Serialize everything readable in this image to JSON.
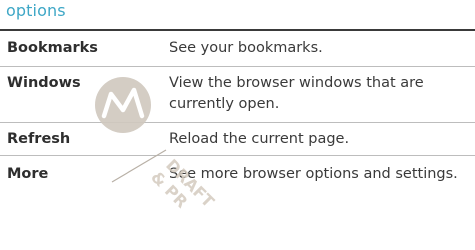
{
  "section": {
    "title": "options"
  },
  "options": [
    {
      "term": "Bookmarks",
      "description": "See your bookmarks."
    },
    {
      "term": "Windows",
      "description": "View the browser windows that are currently open."
    },
    {
      "term": "Refresh",
      "description": "Reload the current page."
    },
    {
      "term": "More",
      "description": "See more browser options and settings."
    }
  ],
  "watermark": {
    "text_line1": "DRAFT",
    "text_line2": "& PR",
    "logo_icon": "motorola-batwing-logo",
    "color": "#cfc8be"
  },
  "colors": {
    "title": "#3ea7c6",
    "rule": "#3a3a3a",
    "row_divider": "#bdbdbd"
  }
}
